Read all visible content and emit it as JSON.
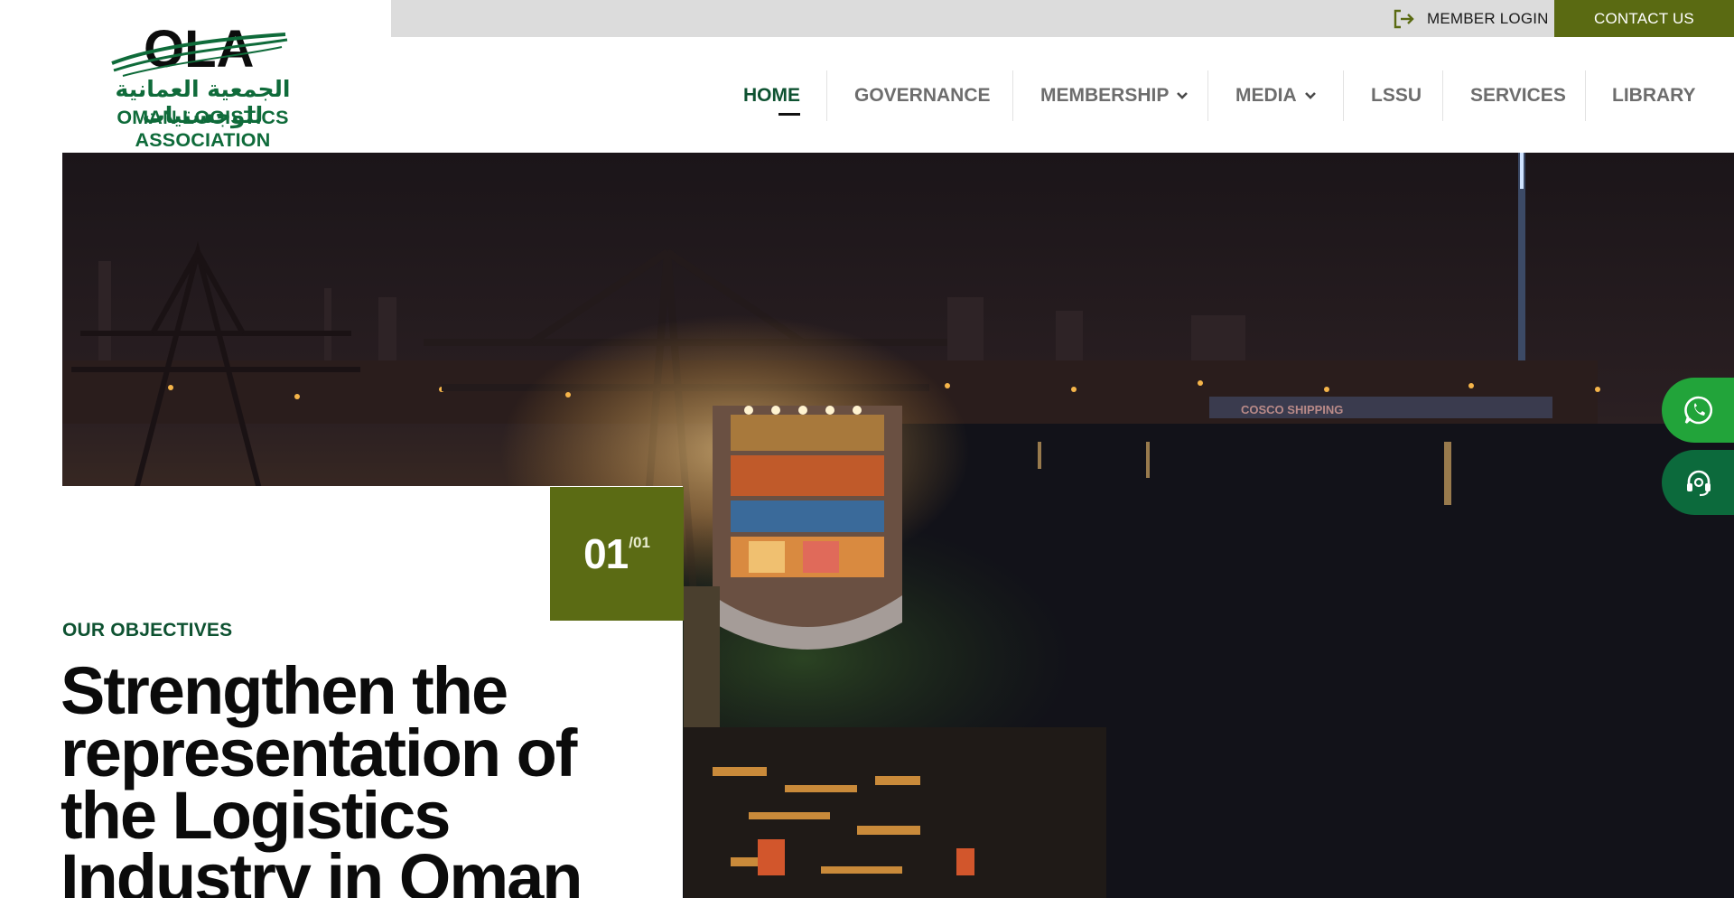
{
  "topbar": {
    "member_login": {
      "label": "MEMBER LOGIN",
      "icon": "login-arrow-icon"
    },
    "contact_button": {
      "label": "CONTACT US"
    },
    "colors": {
      "bar": "#dcdcdc",
      "contact_bg": "#5a6a12"
    }
  },
  "logo": {
    "mark": "OLA",
    "arabic": "الجمعية العمانية للوجستيات",
    "english": "OMAN LOGISTICS ASSOCIATION",
    "colors": {
      "primary": "#0f6b3a",
      "mark": "#0c0c0c"
    }
  },
  "nav": {
    "items": [
      {
        "label": "HOME",
        "active": true,
        "has_dropdown": false
      },
      {
        "label": "GOVERNANCE",
        "active": false,
        "has_dropdown": false
      },
      {
        "label": "MEMBERSHIP",
        "active": false,
        "has_dropdown": true
      },
      {
        "label": "MEDIA",
        "active": false,
        "has_dropdown": true
      },
      {
        "label": "LSSU",
        "active": false,
        "has_dropdown": false
      },
      {
        "label": "SERVICES",
        "active": false,
        "has_dropdown": false
      },
      {
        "label": "LIBRARY",
        "active": false,
        "has_dropdown": false
      }
    ],
    "colors": {
      "active": "#0e5231",
      "inactive": "#6d6d6d"
    }
  },
  "hero": {
    "image_description": "night harbor container port with cranes and cargo ship",
    "ship_marking": "COSCO SHIPPING",
    "slide_counter": {
      "current": "01",
      "total": "/01"
    },
    "eyebrow": "OUR OBJECTIVES",
    "headline_lines": [
      "Strengthen the",
      "representation of",
      "the Logistics",
      "Industry in Oman"
    ],
    "colors": {
      "counter_bg": "#5b6b14",
      "eyebrow": "#0e5231"
    }
  },
  "floating_buttons": [
    {
      "name": "whatsapp",
      "icon": "whatsapp-icon",
      "color": "#22a43a"
    },
    {
      "name": "support",
      "icon": "headset-icon",
      "color": "#0c6a3c"
    }
  ]
}
